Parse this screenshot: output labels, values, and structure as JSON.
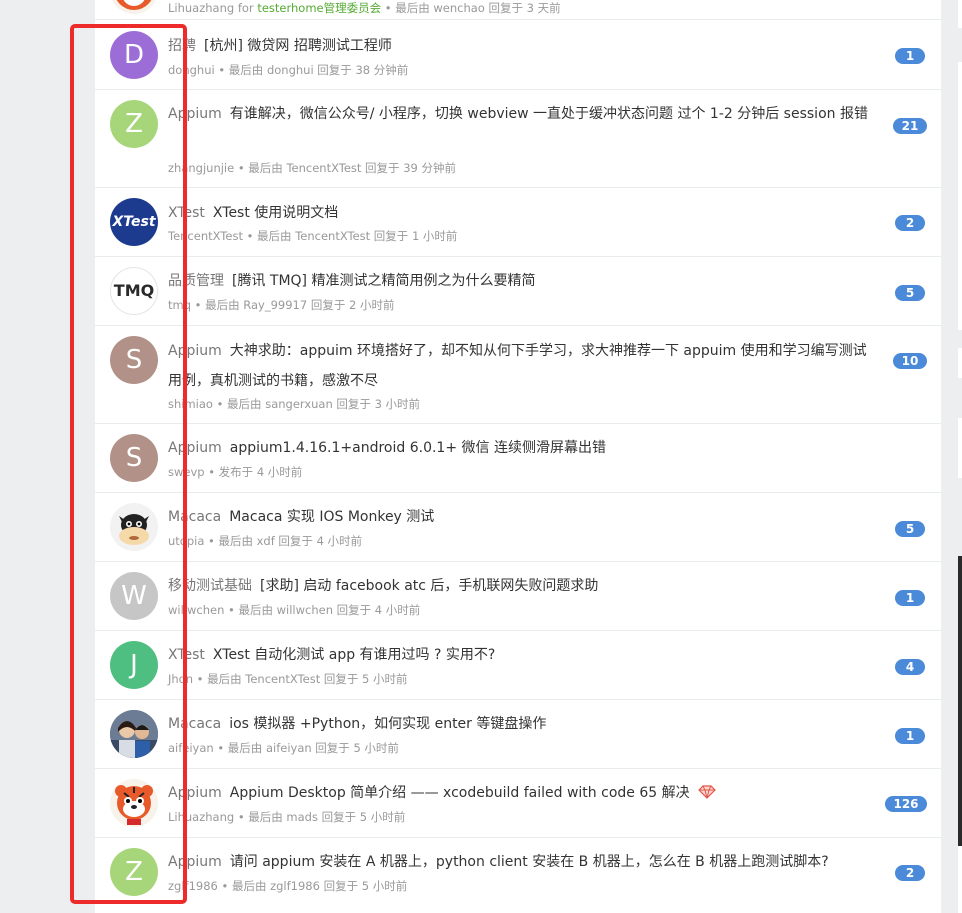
{
  "partial_topic": {
    "user": "Lihuazhang",
    "for_text": " for ",
    "group": "testerhome管理委员会",
    "rest": " • 最后由 wenchao 回复于 3 天前"
  },
  "colors": {
    "badge": "#4a8ad9",
    "highlight_frame": "#ee2b2b",
    "group_link": "#55aa33"
  },
  "topics": [
    {
      "avatar_letter": "D",
      "avatar_color": "#9c6dd6",
      "node": "招聘",
      "title": "[杭州] 微贷网 招聘测试工程师",
      "meta": "donghui • 最后由 donghui 回复于 38 分钟前",
      "replies": "1"
    },
    {
      "avatar_letter": "Z",
      "avatar_color": "#a7d67a",
      "node": "Appium",
      "title": "有谁解决，微信公众号/ 小程序，切换 webview 一直处于缓冲状态问题 过个 1-2 分钟后 session 报错",
      "meta": "zhangjunjie • 最后由 TencentXTest 回复于 39 分钟前",
      "replies": "21"
    },
    {
      "avatar_letter": "XTest",
      "avatar_color": "#1c3b8f",
      "node": "XTest",
      "title": "XTest 使用说明文档",
      "meta": "TencentXTest • 最后由 TencentXTest 回复于 1 小时前",
      "replies": "2"
    },
    {
      "avatar_letter": "TMQ",
      "avatar_color": "#ffffff",
      "node": "品质管理",
      "title": "[腾讯 TMQ] 精准测试之精简用例之为什么要精简",
      "meta": "tmq • 最后由 Ray_99917 回复于 2 小时前",
      "replies": "5"
    },
    {
      "avatar_letter": "S",
      "avatar_color": "#b29288",
      "node": "Appium",
      "title": "大神求助：appuim 环境搭好了，却不知从何下手学习，求大神推荐一下 appuim 使用和学习编写测试用例，真机测试的书籍，感激不尽",
      "meta": "shimiao • 最后由 sangerxuan 回复于 3 小时前",
      "replies": "10"
    },
    {
      "avatar_letter": "S",
      "avatar_color": "#b29288",
      "node": "Appium",
      "title": "appium1.4.16.1+android 6.0.1+ 微信 连续侧滑屏幕出错",
      "meta": "swevp • 发布于 4 小时前",
      "replies": ""
    },
    {
      "avatar_letter": "",
      "avatar_color": "#f2f2f2",
      "avatar_kind": "cow",
      "node": "Macaca",
      "title": "Macaca 实现 IOS Monkey 测试",
      "meta": "utopia • 最后由 xdf 回复于 4 小时前",
      "replies": "5"
    },
    {
      "avatar_letter": "W",
      "avatar_color": "#c6c6c6",
      "node": "移动测试基础",
      "title": "[求助] 启动 facebook atc 后，手机联网失败问题求助",
      "meta": "willwchen • 最后由 willwchen 回复于 4 小时前",
      "replies": "1"
    },
    {
      "avatar_letter": "J",
      "avatar_color": "#4fbf81",
      "node": "XTest",
      "title": "XTest 自动化测试 app 有谁用过吗 ? 实用不?",
      "meta": "Jhon • 最后由 TencentXTest 回复于 5 小时前",
      "replies": "4"
    },
    {
      "avatar_letter": "",
      "avatar_color": "#5a6b88",
      "avatar_kind": "photo",
      "node": "Macaca",
      "title": "ios 模拟器 +Python，如何实现 enter 等键盘操作",
      "meta": "aifeiyan • 最后由 aifeiyan 回复于 5 小时前",
      "replies": "1"
    },
    {
      "avatar_letter": "",
      "avatar_color": "#f7f2ea",
      "avatar_kind": "tiger",
      "node": "Appium",
      "title": "Appium Desktop 简单介绍 —— xcodebuild failed with code 65 解决",
      "meta": "Lihuazhang • 最后由 mads 回复于 5 小时前",
      "replies": "126",
      "gem_icon": "diamond-icon"
    },
    {
      "avatar_letter": "Z",
      "avatar_color": "#a7d67a",
      "node": "Appium",
      "title": "请问 appium 安装在 A 机器上，python client 安装在 B 机器上，怎么在 B 机器上跑测试脚本?",
      "meta": "zglf1986 • 最后由 zglf1986 回复于 5 小时前",
      "replies": "2"
    }
  ]
}
